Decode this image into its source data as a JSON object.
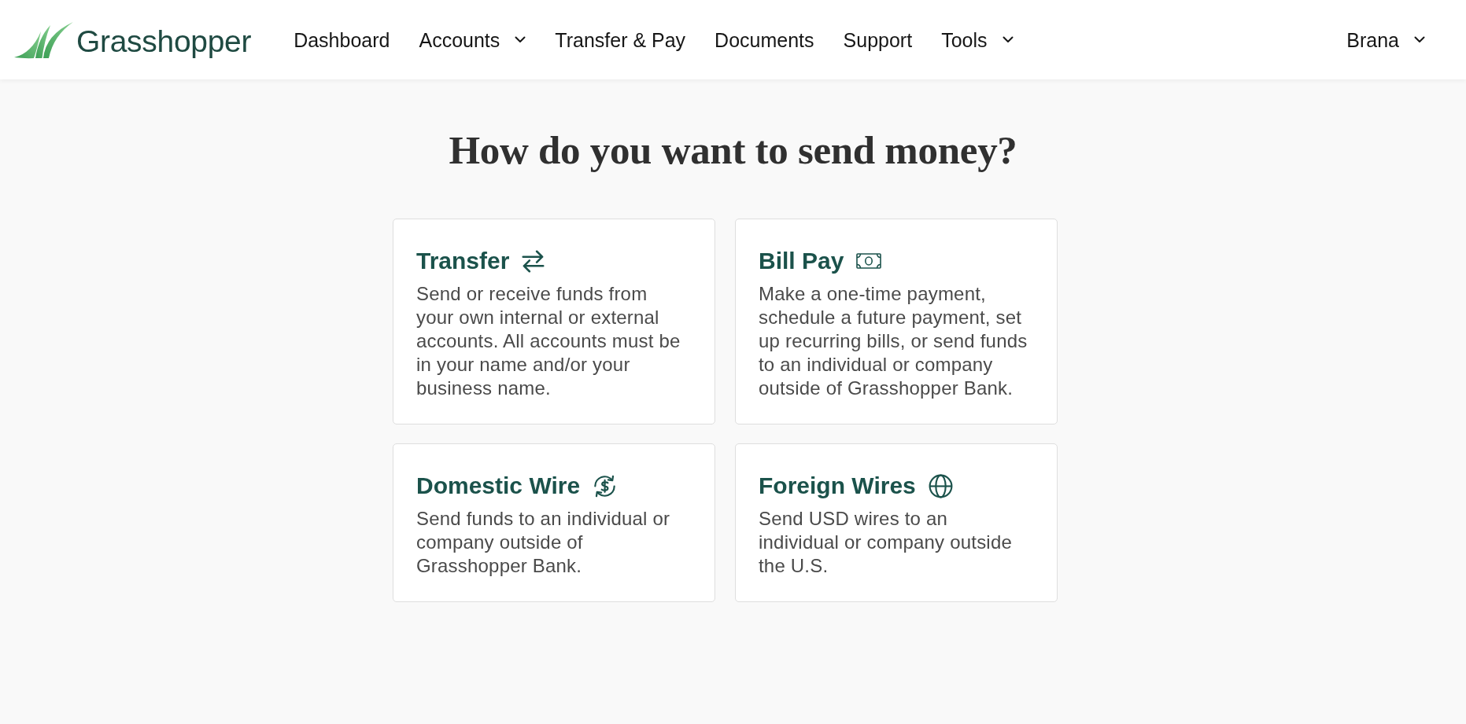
{
  "header": {
    "logo": {
      "text": "Grasshopper"
    },
    "nav": [
      {
        "label": "Dashboard",
        "kind": "link"
      },
      {
        "label": "Accounts",
        "kind": "dropdown"
      },
      {
        "label": "Transfer & Pay",
        "kind": "link"
      },
      {
        "label": "Documents",
        "kind": "link"
      },
      {
        "label": "Support",
        "kind": "link"
      },
      {
        "label": "Tools",
        "kind": "dropdown"
      }
    ],
    "user": {
      "label": "Brana",
      "kind": "dropdown"
    }
  },
  "main": {
    "title": "How do you want to send money?",
    "options": [
      {
        "kind": "transfer",
        "title": "Transfer",
        "description": "Send or receive funds from your own internal or external accounts. All accounts must be in your name and/or your business name."
      },
      {
        "kind": "bill",
        "title": "Bill Pay",
        "description": "Make a one-time payment, schedule a future payment, set up recurring bills, or send funds to an individual or company outside of Grasshopper Bank."
      },
      {
        "kind": "domestic",
        "title": "Domestic Wire",
        "description": "Send funds to an individual or company outside of Grasshopper Bank."
      },
      {
        "kind": "foreign",
        "title": "Foreign Wires",
        "description": "Send USD wires to an individual or company outside the U.S."
      }
    ]
  }
}
